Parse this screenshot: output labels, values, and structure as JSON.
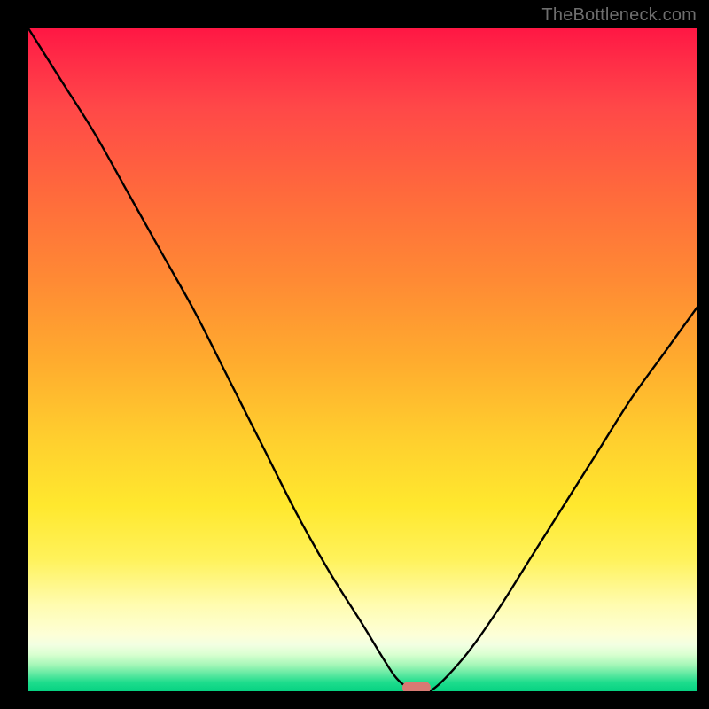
{
  "watermark": "TheBottleneck.com",
  "colors": {
    "frame": "#000000",
    "curve": "#000000",
    "marker": "#d87a73",
    "watermark": "#6e6e6e"
  },
  "chart_data": {
    "type": "line",
    "title": "",
    "xlabel": "",
    "ylabel": "",
    "xlim": [
      0,
      100
    ],
    "ylim": [
      0,
      100
    ],
    "grid": false,
    "legend": false,
    "series": [
      {
        "name": "bottleneck-curve",
        "x": [
          0,
          5,
          10,
          15,
          20,
          25,
          30,
          35,
          40,
          45,
          50,
          53,
          55,
          57,
          60,
          65,
          70,
          75,
          80,
          85,
          90,
          95,
          100
        ],
        "values": [
          100,
          92,
          84,
          75,
          66,
          57,
          47,
          37,
          27,
          18,
          10,
          5,
          2,
          0.5,
          0,
          5,
          12,
          20,
          28,
          36,
          44,
          51,
          58
        ]
      }
    ],
    "annotations": [
      {
        "name": "optimal-marker",
        "x": 58,
        "y": 0,
        "shape": "pill",
        "color": "#d87a73"
      }
    ],
    "background_gradient": [
      {
        "pos": 0,
        "color": "#ff1744"
      },
      {
        "pos": 0.25,
        "color": "#ff6a3c"
      },
      {
        "pos": 0.5,
        "color": "#ffab2e"
      },
      {
        "pos": 0.72,
        "color": "#ffe82e"
      },
      {
        "pos": 0.9,
        "color": "#fdffd7"
      },
      {
        "pos": 1.0,
        "color": "#06d282"
      }
    ]
  }
}
